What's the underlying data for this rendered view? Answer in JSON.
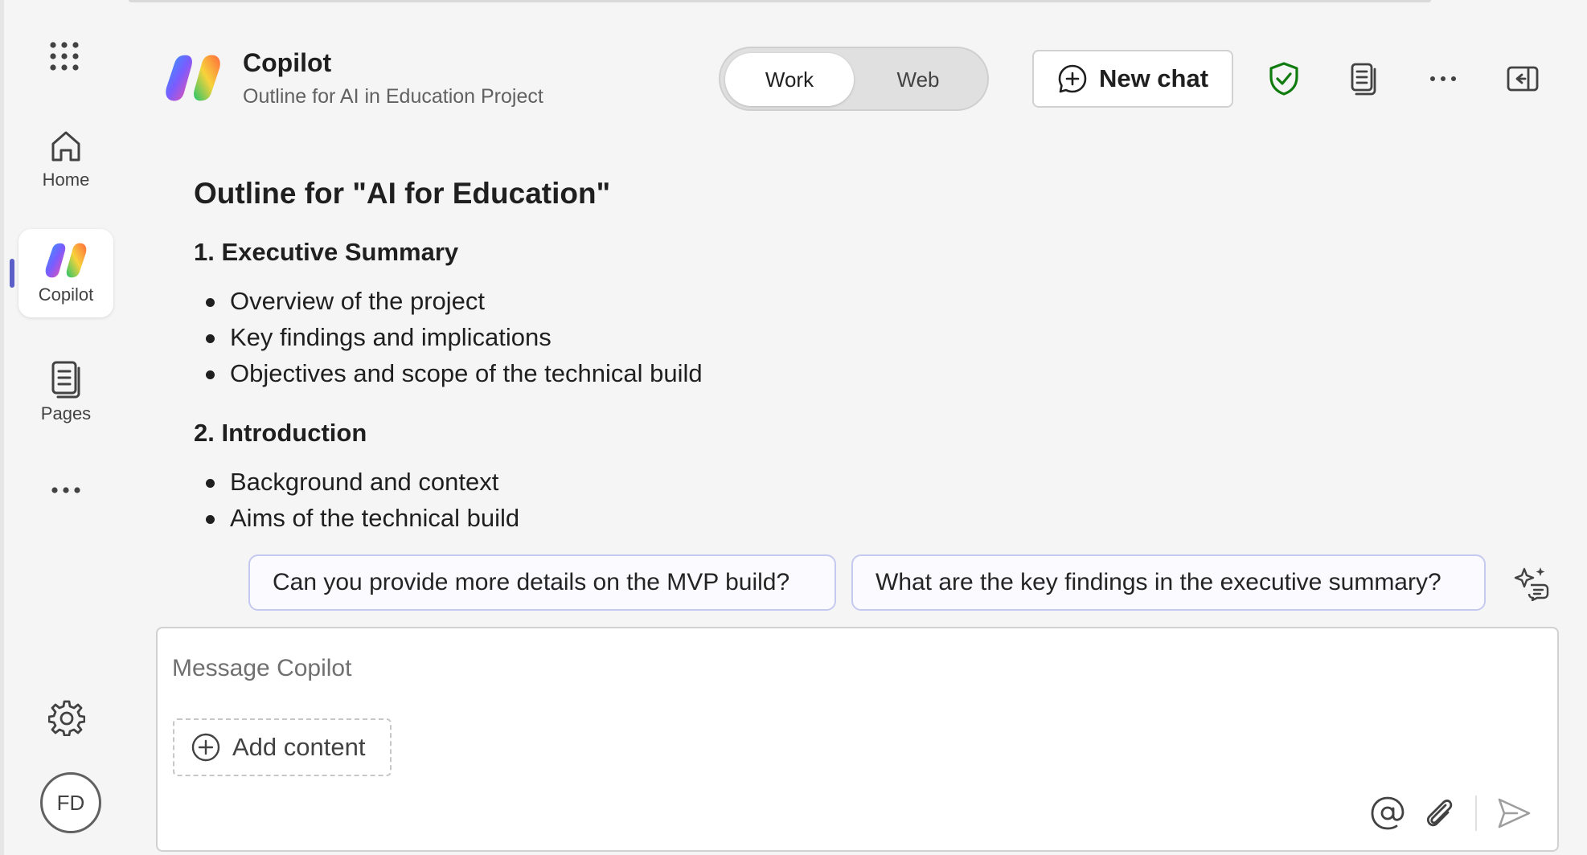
{
  "rail": {
    "apps_icon": "app-launcher-grid-icon",
    "items": [
      {
        "id": "home",
        "label": "Home",
        "icon": "home-icon"
      },
      {
        "id": "copilot",
        "label": "Copilot",
        "icon": "copilot-logo-icon",
        "active": true
      },
      {
        "id": "pages",
        "label": "Pages",
        "icon": "pages-icon"
      }
    ],
    "more_icon": "more-horizontal-icon",
    "settings_icon": "gear-icon",
    "avatar_initials": "FD"
  },
  "header": {
    "title": "Copilot",
    "subtitle": "Outline for AI in Education Project",
    "mode_toggle": {
      "options": [
        "Work",
        "Web"
      ],
      "selected": "Work"
    },
    "new_chat_label": "New chat",
    "icons": [
      "shield-check-icon",
      "document-icon",
      "more-horizontal-icon",
      "panel-collapse-icon"
    ]
  },
  "content": {
    "title": "Outline for \"AI for Education\"",
    "sections": [
      {
        "heading": "1. Executive Summary",
        "bullets": [
          "Overview of the project",
          "Key findings and implications",
          "Objectives and scope of the technical build"
        ]
      },
      {
        "heading": "2. Introduction",
        "bullets": [
          "Background and context",
          "Aims of the technical build"
        ]
      }
    ]
  },
  "suggestions": [
    "Can you provide more details on the MVP build?",
    "What are the key findings in the executive summary?"
  ],
  "composer": {
    "placeholder": "Message Copilot",
    "add_content_label": "Add content",
    "icons": [
      "mention-icon",
      "paperclip-icon",
      "send-icon"
    ]
  },
  "colors": {
    "accent": "#5b5fc7",
    "shield": "#107c10",
    "background": "#f5f5f5"
  }
}
